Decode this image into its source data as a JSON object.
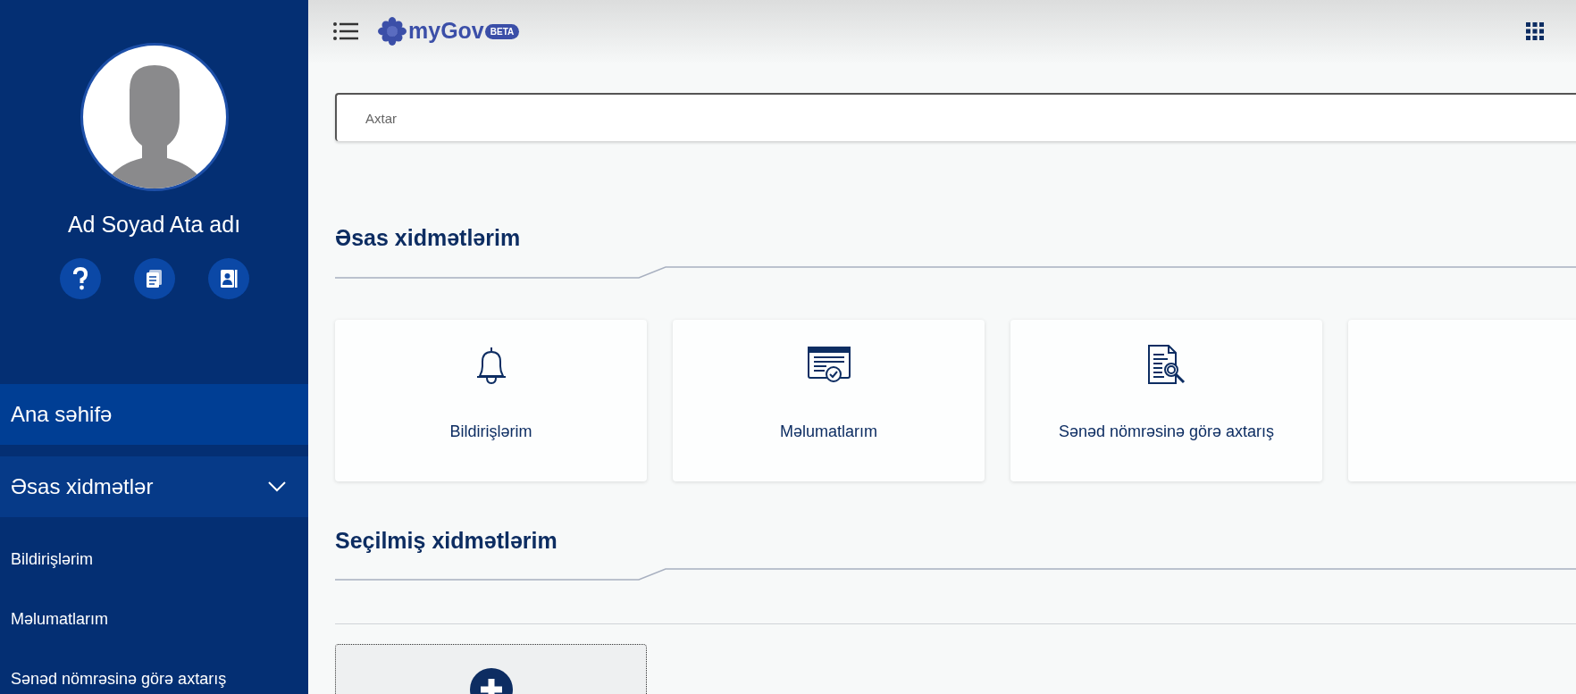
{
  "sidebar": {
    "user_name": "Ad Soyad Ata adı",
    "menu": [
      {
        "label": "Ana səhifə",
        "selected": true
      },
      {
        "label": "Əsas xidmətlər",
        "selected": false,
        "expanded": true,
        "children": [
          {
            "label": "Bildirişlərim"
          },
          {
            "label": "Məlumatlarım"
          },
          {
            "label": "Sənəd nömrəsinə görə axtarış"
          }
        ]
      }
    ]
  },
  "topbar": {
    "logo": "myGov",
    "badge": "BETA"
  },
  "search": {
    "placeholder": "Axtar"
  },
  "sections": [
    {
      "title": "Əsas xidmətlərim",
      "cards": [
        {
          "kind": "bell",
          "label": "Bildirişlərim"
        },
        {
          "kind": "certificate",
          "label": "Məlumatlarım"
        },
        {
          "kind": "document-search",
          "label": "Sənəd nömrəsinə görə axtarış"
        },
        {
          "kind": "empty"
        }
      ]
    },
    {
      "title": "Seçilmiş xidmətlərim",
      "cards": [
        {
          "kind": "add"
        }
      ]
    }
  ]
}
